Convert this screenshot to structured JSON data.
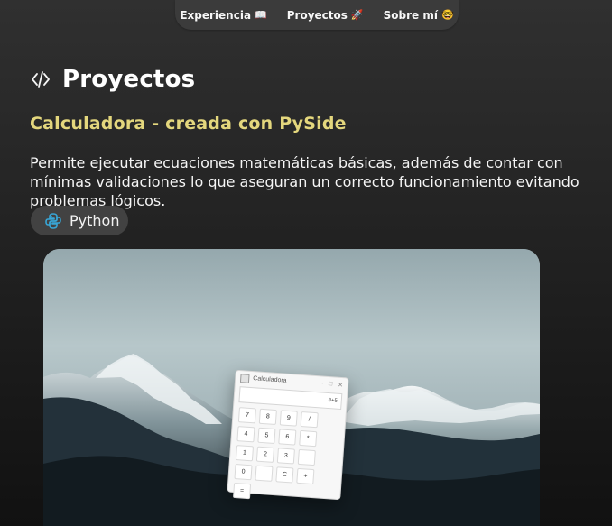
{
  "nav": {
    "items": [
      {
        "label": "Experiencia",
        "emoji": "📖"
      },
      {
        "label": "Proyectos",
        "emoji": "🚀"
      },
      {
        "label": "Sobre mí",
        "emoji": "🤓"
      }
    ]
  },
  "section": {
    "title": "Proyectos",
    "icon": "code-icon"
  },
  "project": {
    "title": "Calculadora - creada con PySide",
    "description": "Permite ejecutar ecuaciones matemáticas básicas, además de contar con mínimas validaciones lo que aseguran un correcto funcionamiento evitando problemas lógicos.",
    "technology": {
      "label": "Python",
      "icon": "python-icon"
    },
    "preview": {
      "calculator": {
        "window_title": "Calculadora",
        "display_value": "8+5",
        "keys": [
          "7",
          "8",
          "9",
          "/",
          "4",
          "5",
          "6",
          "*",
          "1",
          "2",
          "3",
          "-",
          "0",
          ".",
          "C",
          "+",
          "="
        ]
      }
    }
  },
  "colors": {
    "background": "#262626",
    "navbar": "#3b3b3b",
    "accent": "#e4d77d",
    "badge": "#424242",
    "python_blue": "#38a7d8"
  }
}
